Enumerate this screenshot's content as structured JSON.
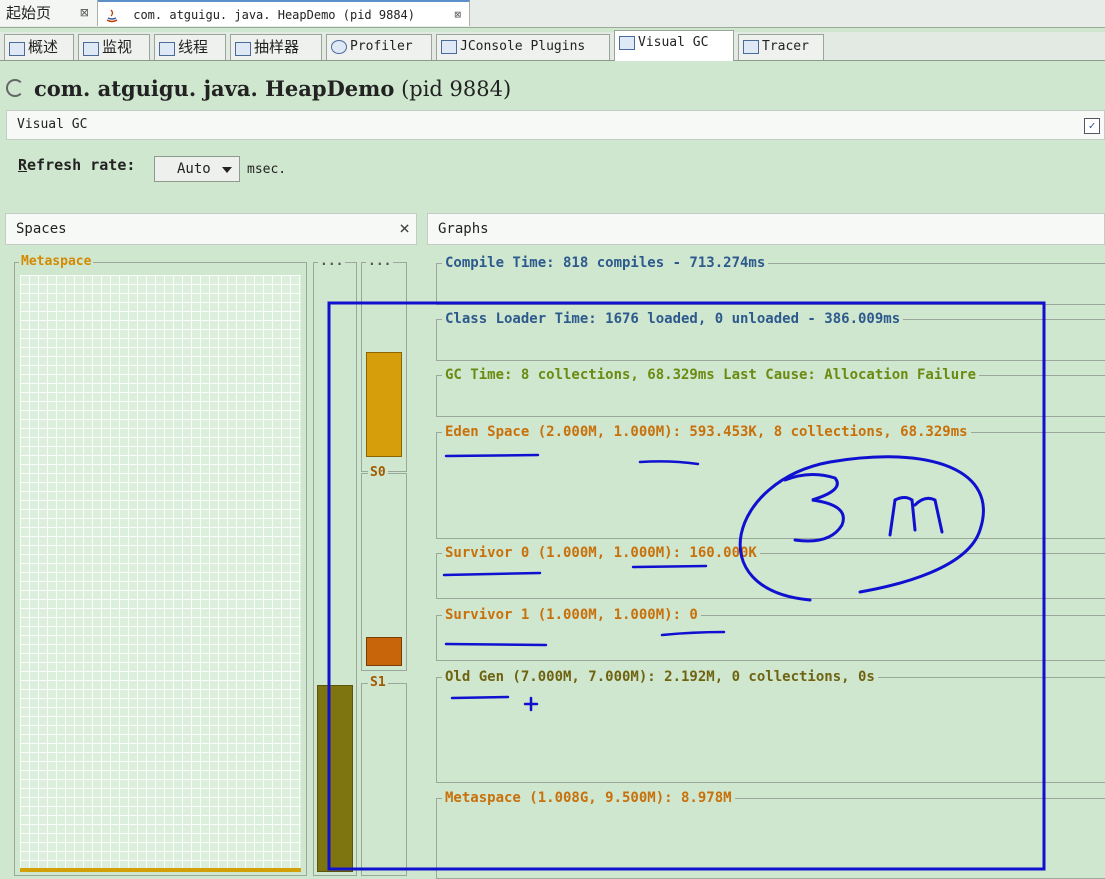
{
  "doc_tabs": [
    {
      "label": "起始页",
      "close": "⊠"
    },
    {
      "label": "com. atguigu. java. HeapDemo  (pid 9884)",
      "close": "⊠"
    }
  ],
  "tool_tabs": [
    {
      "label": "概述",
      "icon": "overview-icon"
    },
    {
      "label": "监视",
      "icon": "monitor-icon"
    },
    {
      "label": "线程",
      "icon": "threads-icon"
    },
    {
      "label": "抽样器",
      "icon": "sampler-icon"
    },
    {
      "label": "Profiler",
      "icon": "profiler-icon"
    },
    {
      "label": "JConsole Plugins",
      "icon": "jconsole-icon"
    },
    {
      "label": "Visual GC",
      "icon": "visualgc-icon"
    },
    {
      "label": "Tracer",
      "icon": "tracer-icon"
    }
  ],
  "header": {
    "app_name": "com. atguigu. java. HeapDemo",
    "pid": "(pid 9884)"
  },
  "view_title": "Visual GC",
  "refresh": {
    "label_rest": "efresh rate:",
    "label_mnemonic": "R",
    "value": "Auto",
    "unit": "msec."
  },
  "spaces_panel": {
    "title": "Spaces",
    "close": "×",
    "metaspace_label": "Metaspace",
    "old_label": "...",
    "eden_label": "...",
    "s0_label": "S0",
    "s1_label": "S1",
    "old_fill_ratio": 0.31,
    "eden_fill_ratio": 0.56,
    "s0_fill_ratio": 0.15,
    "s1_fill_ratio": 0.0,
    "metaspace_fill_ratio": 0.01
  },
  "graphs_panel": {
    "title": "Graphs",
    "compile_time": "Compile Time: 818 compiles - 713.274ms",
    "class_loader": "Class Loader Time: 1676 loaded, 0 unloaded - 386.009ms",
    "gc_time": "GC Time: 8 collections, 68.329ms Last Cause: Allocation Failure",
    "eden": "Eden Space (2.000M, 1.000M): 593.453K, 8 collections, 68.329ms",
    "survivor0": "Survivor 0 (1.000M, 1.000M): 160.000K",
    "survivor1": "Survivor 1 (1.000M, 1.000M): 0",
    "old_gen": "Old Gen (7.000M, 7.000M): 2.192M, 0 collections, 0s",
    "metaspace": "Metaspace (1.008G, 9.500M): 8.978M"
  },
  "annotation": {
    "text": "3m",
    "color": "#1010d0"
  }
}
